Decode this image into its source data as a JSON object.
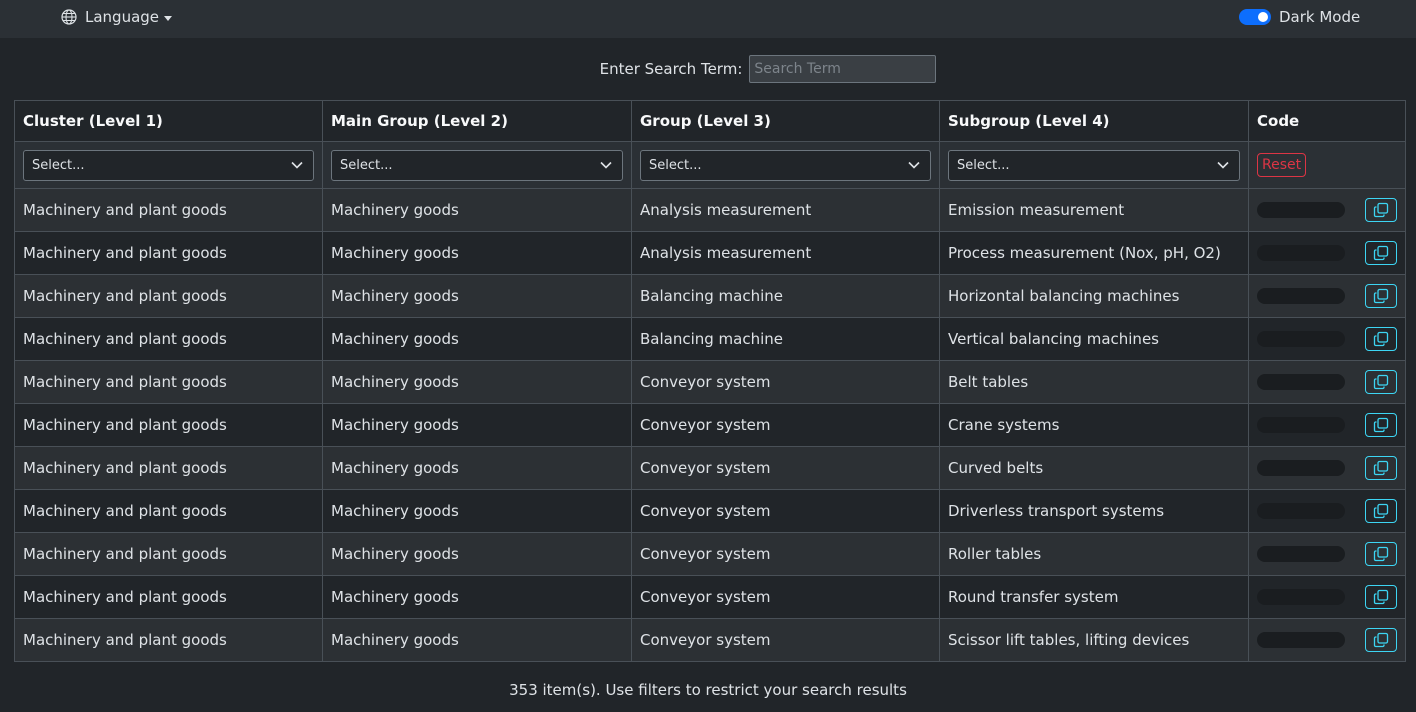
{
  "topbar": {
    "language_label": "Language",
    "dark_mode_label": "Dark Mode",
    "dark_mode_on": true
  },
  "search": {
    "label": "Enter Search Term:",
    "placeholder": "Search Term",
    "value": ""
  },
  "table": {
    "columns": [
      "Cluster (Level 1)",
      "Main Group (Level 2)",
      "Group (Level 3)",
      "Subgroup (Level 4)",
      "Code"
    ],
    "filters": [
      "Select...",
      "Select...",
      "Select...",
      "Select..."
    ],
    "reset_label": "Reset",
    "rows": [
      [
        "Machinery and plant goods",
        "Machinery goods",
        "Analysis measurement",
        "Emission measurement"
      ],
      [
        "Machinery and plant goods",
        "Machinery goods",
        "Analysis measurement",
        "Process measurement (Nox, pH, O2)"
      ],
      [
        "Machinery and plant goods",
        "Machinery goods",
        "Balancing machine",
        "Horizontal balancing machines"
      ],
      [
        "Machinery and plant goods",
        "Machinery goods",
        "Balancing machine",
        "Vertical balancing machines"
      ],
      [
        "Machinery and plant goods",
        "Machinery goods",
        "Conveyor system",
        "Belt tables"
      ],
      [
        "Machinery and plant goods",
        "Machinery goods",
        "Conveyor system",
        "Crane systems"
      ],
      [
        "Machinery and plant goods",
        "Machinery goods",
        "Conveyor system",
        "Curved belts"
      ],
      [
        "Machinery and plant goods",
        "Machinery goods",
        "Conveyor system",
        "Driverless transport systems"
      ],
      [
        "Machinery and plant goods",
        "Machinery goods",
        "Conveyor system",
        "Roller tables"
      ],
      [
        "Machinery and plant goods",
        "Machinery goods",
        "Conveyor system",
        "Round transfer system"
      ],
      [
        "Machinery and plant goods",
        "Machinery goods",
        "Conveyor system",
        "Scissor lift tables, lifting devices"
      ]
    ]
  },
  "footer": {
    "status": "353 item(s). Use filters to restrict your search results"
  },
  "colors": {
    "background": "#212529",
    "topbar": "#2b3035",
    "accent": "#0d6efd",
    "reset": "#dc3545",
    "copy": "#3dd5f3"
  }
}
